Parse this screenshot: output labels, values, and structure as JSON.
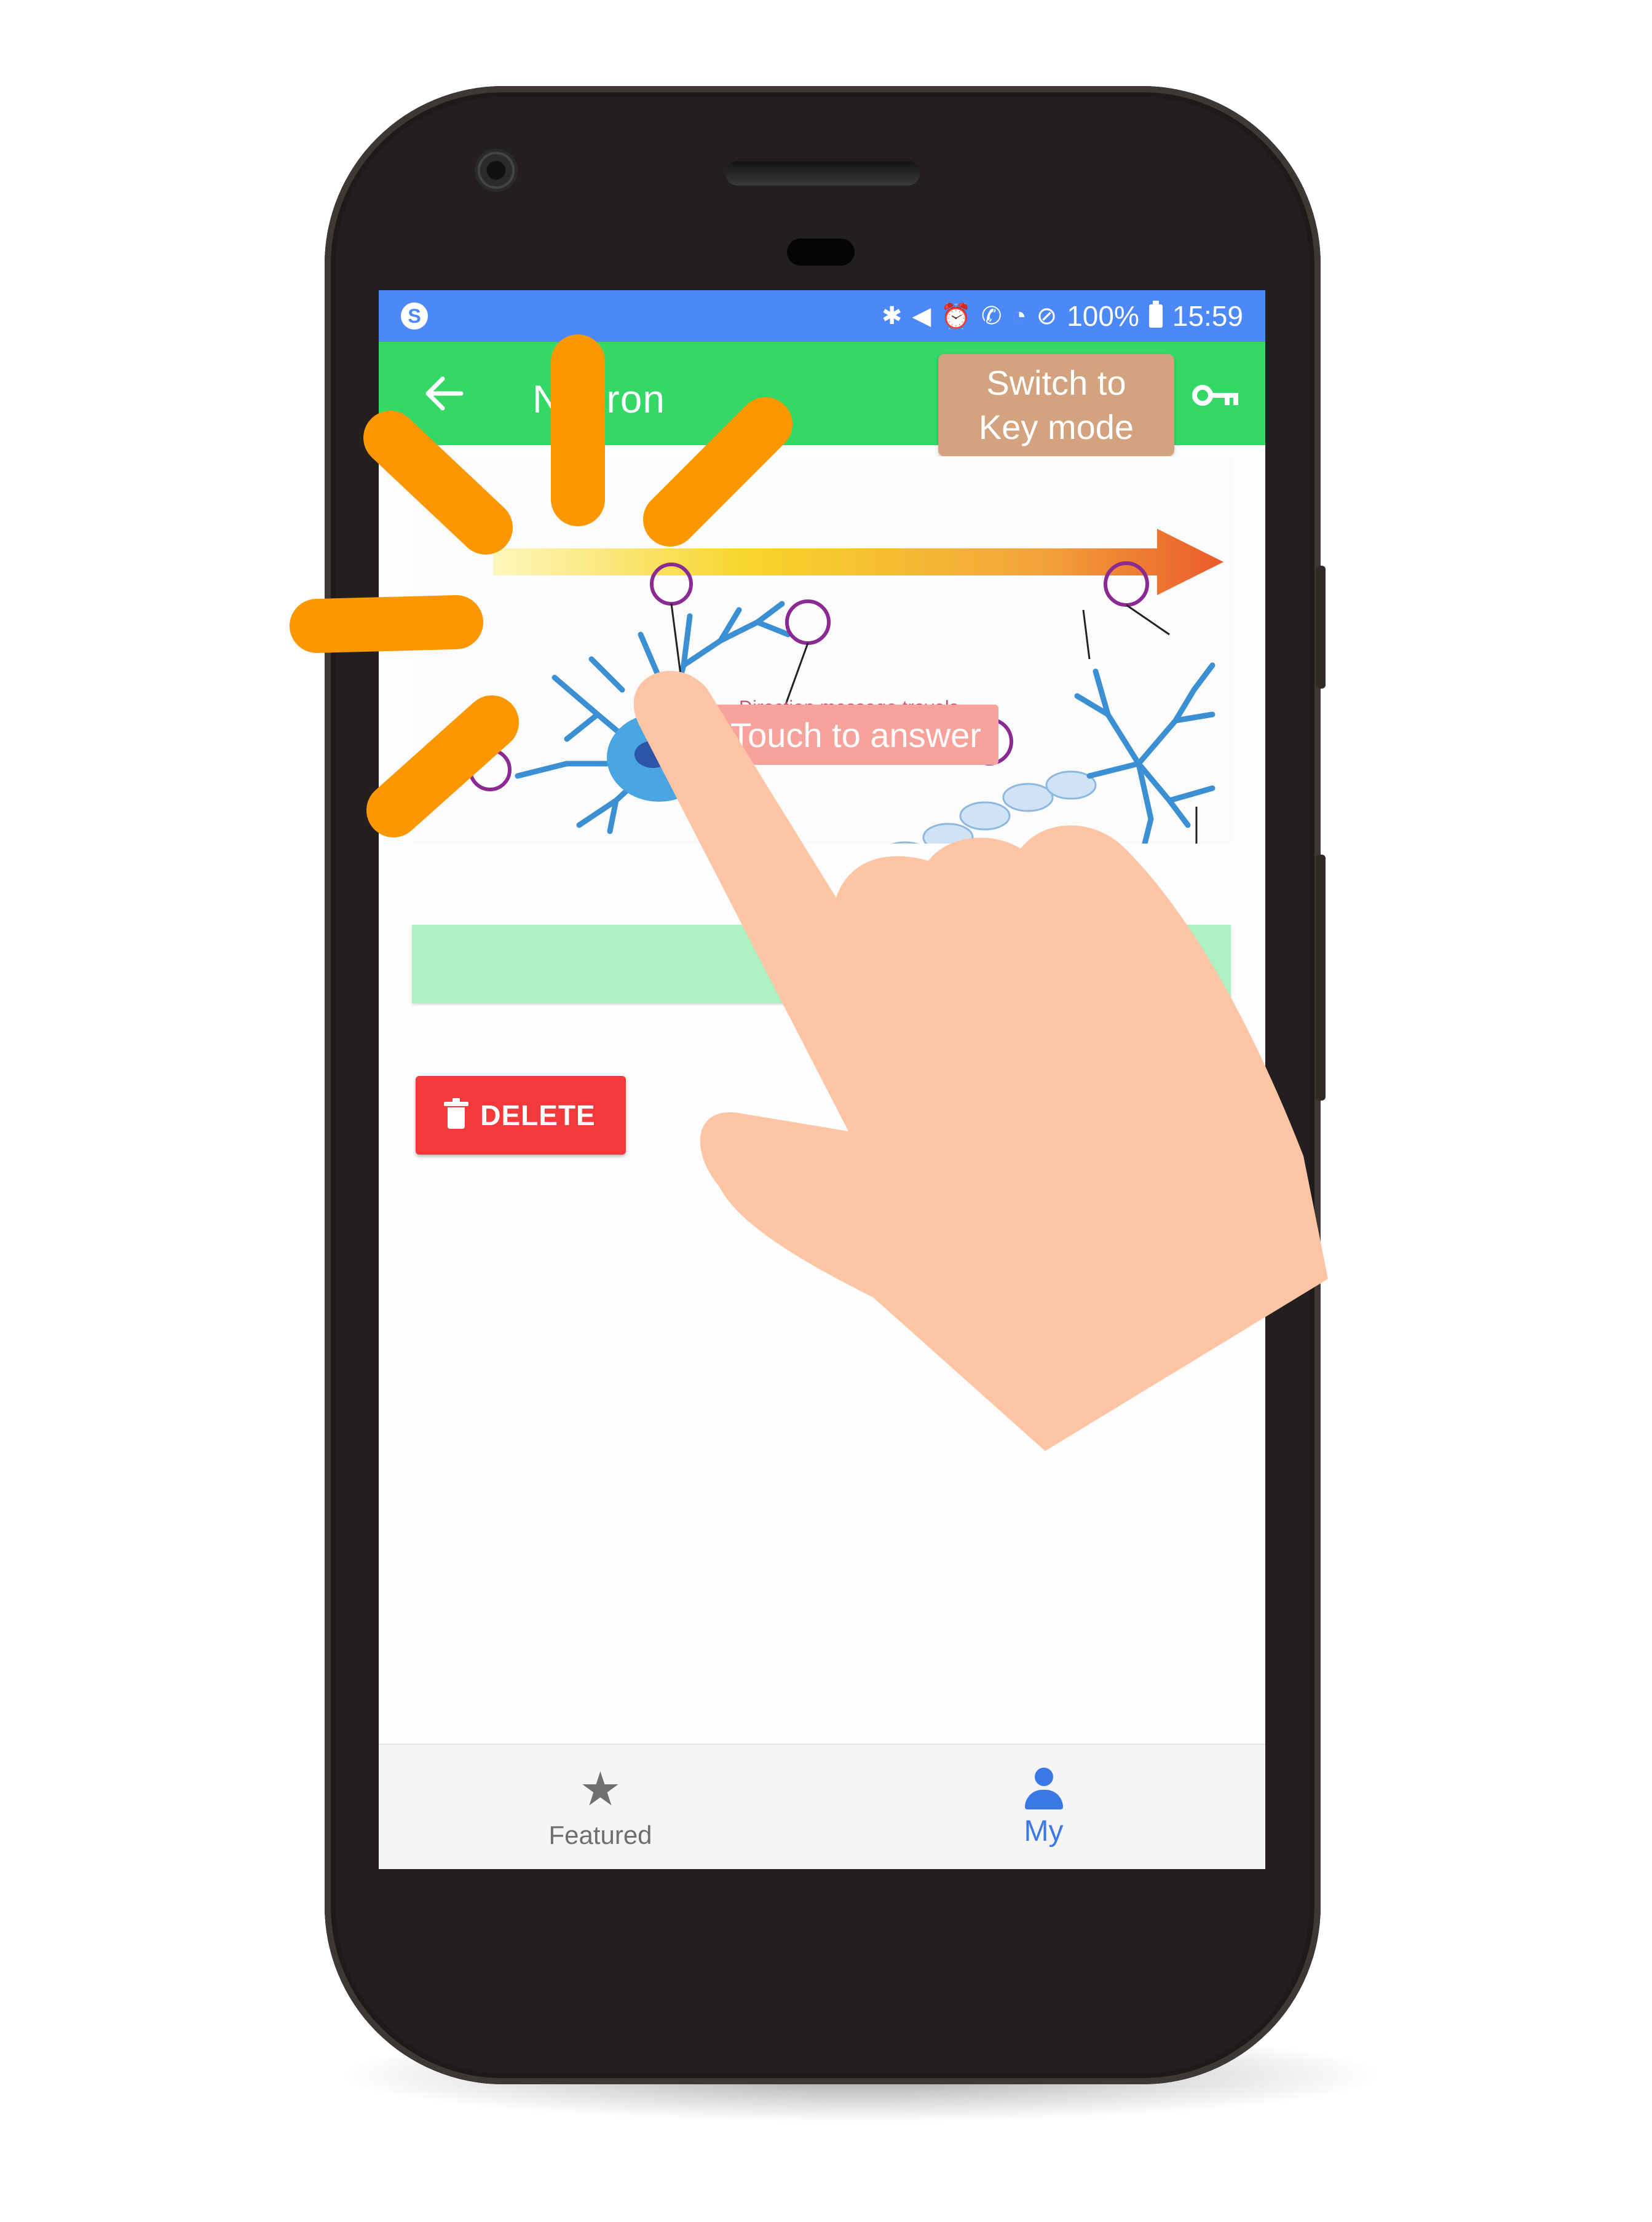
{
  "status_bar": {
    "app_icon_glyph": "S",
    "icons": [
      "bluetooth-icon",
      "mute-icon",
      "alarm-icon",
      "wifi-call-icon",
      "wifi-icon",
      "no-disturb-icon",
      "battery-icon"
    ],
    "battery": "100%",
    "time": "15:59"
  },
  "app_bar": {
    "title": "Neuron",
    "mode_button_line1": "Switch to",
    "mode_button_line2": "Key mode"
  },
  "diagram": {
    "direction_text": "Direction message travels",
    "touch_label": "Touch to answer"
  },
  "actions": {
    "delete_label": "DELETE"
  },
  "bottom_nav": {
    "items": [
      {
        "label": "Featured",
        "icon": "star-icon",
        "active": false
      },
      {
        "label": "My",
        "icon": "person-icon",
        "active": true
      }
    ]
  },
  "colors": {
    "status_bar": "#4d88f8",
    "app_bar": "#34d866",
    "mode_button": "#d3a37f",
    "touch_label": "#f7a39c",
    "answer_bar": "#aef0c2",
    "delete_button": "#f23a3b",
    "active_nav": "#3a78e8",
    "burst": "#fb9700",
    "hand": "#fdc5a3"
  }
}
